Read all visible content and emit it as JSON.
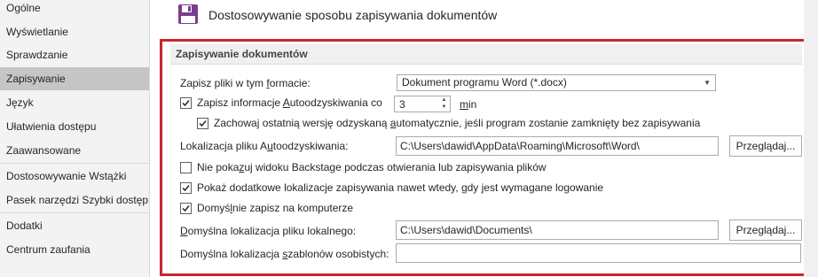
{
  "sidebar": {
    "items": [
      {
        "label": "Ogólne"
      },
      {
        "label": "Wyświetlanie"
      },
      {
        "label": "Sprawdzanie"
      },
      {
        "label": "Zapisywanie"
      },
      {
        "label": "Język"
      },
      {
        "label": "Ułatwienia dostępu"
      },
      {
        "label": "Zaawansowane"
      },
      {
        "label": "Dostosowywanie Wstążki"
      },
      {
        "label": "Pasek narzędzi Szybki dostęp"
      },
      {
        "label": "Dodatki"
      },
      {
        "label": "Centrum zaufania"
      }
    ],
    "selected": "Zapisywanie"
  },
  "header": {
    "icon": "floppy-disk-icon",
    "title": "Dostosowywanie sposobu zapisywania dokumentów"
  },
  "section": {
    "title": "Zapisywanie dokumentów",
    "format": {
      "label_pre": "Zapisz pliki w tym ",
      "label_u": "f",
      "label_post": "ormacie:",
      "value": "Dokument programu Word (*.docx)"
    },
    "autorecover": {
      "label_pre": "Zapisz informacje ",
      "label_u": "A",
      "label_post": "utoodzyskiwania co",
      "checked": true,
      "minutes": "3",
      "unit_u": "m",
      "unit_post": "in"
    },
    "keep_last": {
      "label_pre": "Zachowaj ostatnią wersję odzyskaną ",
      "label_u": "a",
      "label_post": "utomatycznie, jeśli program zostanie zamknięty bez zapisywania",
      "checked": true
    },
    "autorecover_location": {
      "label_pre": "Lokalizacja pliku A",
      "label_u": "u",
      "label_post": "toodzyskiwania:",
      "value": "C:\\Users\\dawid\\AppData\\Roaming\\Microsoft\\Word\\",
      "button": "Przeglądaj..."
    },
    "no_backstage": {
      "label_pre": "Nie poka",
      "label_u": "z",
      "label_post": "uj widoku Backstage podczas otwierania lub zapisywania plików",
      "checked": false
    },
    "show_locations": {
      "label_pre": "Pokaż dodatkowe lokalizacje zapisywania nawet wtedy, ",
      "label_u": "g",
      "label_post": "dy jest wymagane logowanie",
      "checked": true
    },
    "save_to_computer": {
      "label_pre": "Domyś",
      "label_u": "l",
      "label_post": "nie zapisz na komputerze",
      "checked": true
    },
    "local_location": {
      "label_pre": "",
      "label_u": "D",
      "label_post": "omyślna lokalizacja pliku lokalnego:",
      "value": "C:\\Users\\dawid\\Documents\\",
      "button": "Przeglądaj..."
    },
    "templates_location": {
      "label_pre": "Domyślna lokalizacja ",
      "label_u": "s",
      "label_post": "zablonów osobistych:",
      "value": ""
    }
  },
  "colors": {
    "highlight": "#c7262f",
    "selected_nav": "#c5c5c5",
    "floppy": "#7b3d8e"
  }
}
